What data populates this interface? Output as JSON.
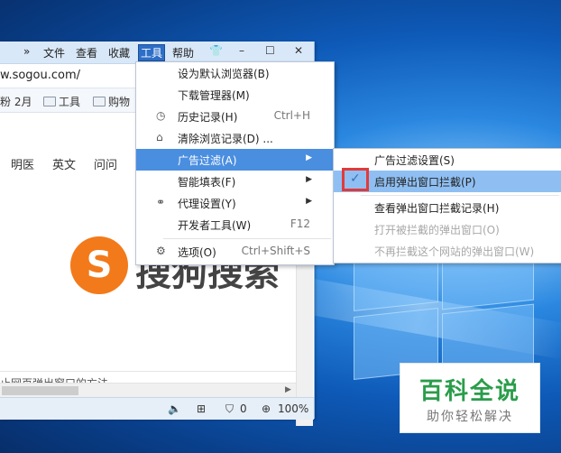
{
  "menubar": {
    "overflow": "»",
    "items": [
      "文件",
      "查看",
      "收藏",
      "工具",
      "帮助"
    ],
    "active_item": "工具",
    "controls": [
      "👕",
      "–",
      "☐",
      "✕"
    ]
  },
  "address": {
    "url": "w.sogou.com/"
  },
  "favorites": [
    {
      "label": "粉 2月",
      "folder": false
    },
    {
      "label": "工具",
      "folder": true
    },
    {
      "label": "购物",
      "folder": true
    }
  ],
  "page_nav": [
    "明医",
    "英文",
    "问问"
  ],
  "logo": {
    "glyph": "S",
    "text": "搜狗搜索"
  },
  "footer_tip": "止网页弹出窗口的方法",
  "status": {
    "blocked_count": "0",
    "zoom": "100%"
  },
  "tools_menu": {
    "items": [
      {
        "label": "设为默认浏览器(B)",
        "shortcut": "",
        "icon": "",
        "submenu": false
      },
      {
        "label": "下载管理器(M)",
        "shortcut": "",
        "icon": "",
        "submenu": false
      },
      {
        "label": "历史记录(H)",
        "shortcut": "Ctrl+H",
        "icon": "clock-icon",
        "submenu": false
      },
      {
        "label": "清除浏览记录(D) ...",
        "shortcut": "",
        "icon": "broom-icon",
        "submenu": false
      },
      {
        "label": "广告过滤(A)",
        "shortcut": "",
        "icon": "",
        "submenu": true
      },
      {
        "label": "智能填表(F)",
        "shortcut": "",
        "icon": "",
        "submenu": true
      },
      {
        "label": "代理设置(Y)",
        "shortcut": "",
        "icon": "link-icon",
        "submenu": true
      },
      {
        "label": "开发者工具(W)",
        "shortcut": "F12",
        "icon": "",
        "submenu": false
      },
      {
        "label": "选项(O)",
        "shortcut": "Ctrl+Shift+S",
        "icon": "gear-icon",
        "submenu": false
      }
    ],
    "highlighted": "广告过滤(A)"
  },
  "ad_filter_submenu": {
    "items": [
      {
        "label": "广告过滤设置(S)",
        "disabled": false,
        "checked": false
      },
      {
        "label": "启用弹出窗口拦截(P)",
        "disabled": false,
        "checked": true
      },
      {
        "label": "查看弹出窗口拦截记录(H)",
        "disabled": false,
        "checked": false
      },
      {
        "label": "打开被拦截的弹出窗口(O)",
        "disabled": true,
        "checked": false
      },
      {
        "label": "不再拦截这个网站的弹出窗口(W)",
        "disabled": true,
        "checked": false
      }
    ]
  },
  "watermark": {
    "title": "百科全说",
    "subtitle": "助你轻松解决"
  }
}
